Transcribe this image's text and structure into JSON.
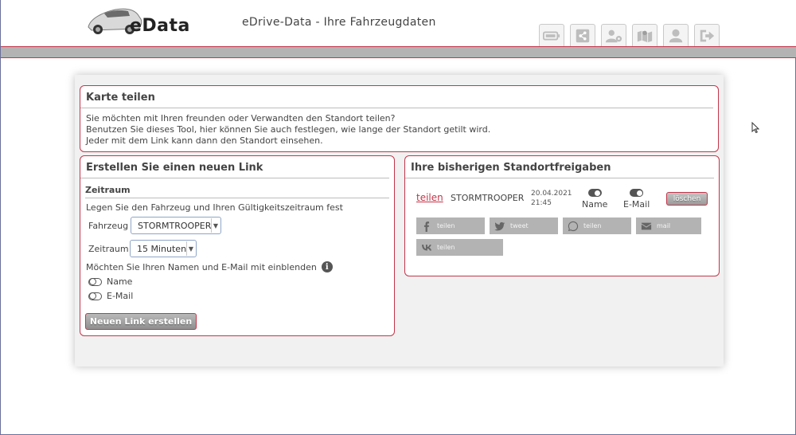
{
  "header": {
    "logo_text": "eData",
    "site_title": "eDrive-Data - Ihre Fahrzeugdaten",
    "nav": [
      "battery-icon",
      "share-icon",
      "user-settings-icon",
      "map-icon",
      "user-icon",
      "logout-icon"
    ]
  },
  "share_card": {
    "title": "Karte teilen",
    "lines": [
      "Sie möchten mit Ihren freunden oder Verwandten den Standort teilen?",
      "Benutzen Sie dieses Tool, hier können Sie auch festlegen, wie lange der Standort getilt wird.",
      "Jeder mit dem Link kann dann den Standort einsehen."
    ]
  },
  "create_card": {
    "title": "Erstellen Sie einen neuen Link",
    "subtitle": "Zeitraum",
    "intro": "Legen Sie den Fahrzeug und Ihren Gültigkeitszeitraum fest",
    "vehicle_label": "Fahrzeug",
    "vehicle_value": "STORMTROOPER",
    "period_label": "Zeitraum",
    "period_value": "15 Minuten",
    "show_question": "Möchten Sie Ihren Namen und E-Mail mit einblenden",
    "name_toggle_label": "Name",
    "email_toggle_label": "E-Mail",
    "create_button": "Neuen Link erstellen"
  },
  "shares_card": {
    "title": "Ihre bisherigen Standortfreigaben",
    "entry": {
      "share_link": "teilen",
      "vehicle": "STORMTROOPER",
      "date": "20.04.2021",
      "time": "21:45",
      "name_label": "Name",
      "email_label": "E-Mail",
      "delete_button": "löschen"
    },
    "share_buttons": {
      "facebook": "teilen",
      "twitter": "tweet",
      "whatsapp": "teilen",
      "mail": "mail",
      "vk": "teilen"
    }
  },
  "colors": {
    "accent": "#c4364a",
    "band": "#b3b3b3",
    "panel_bg": "#f1f1f1"
  }
}
